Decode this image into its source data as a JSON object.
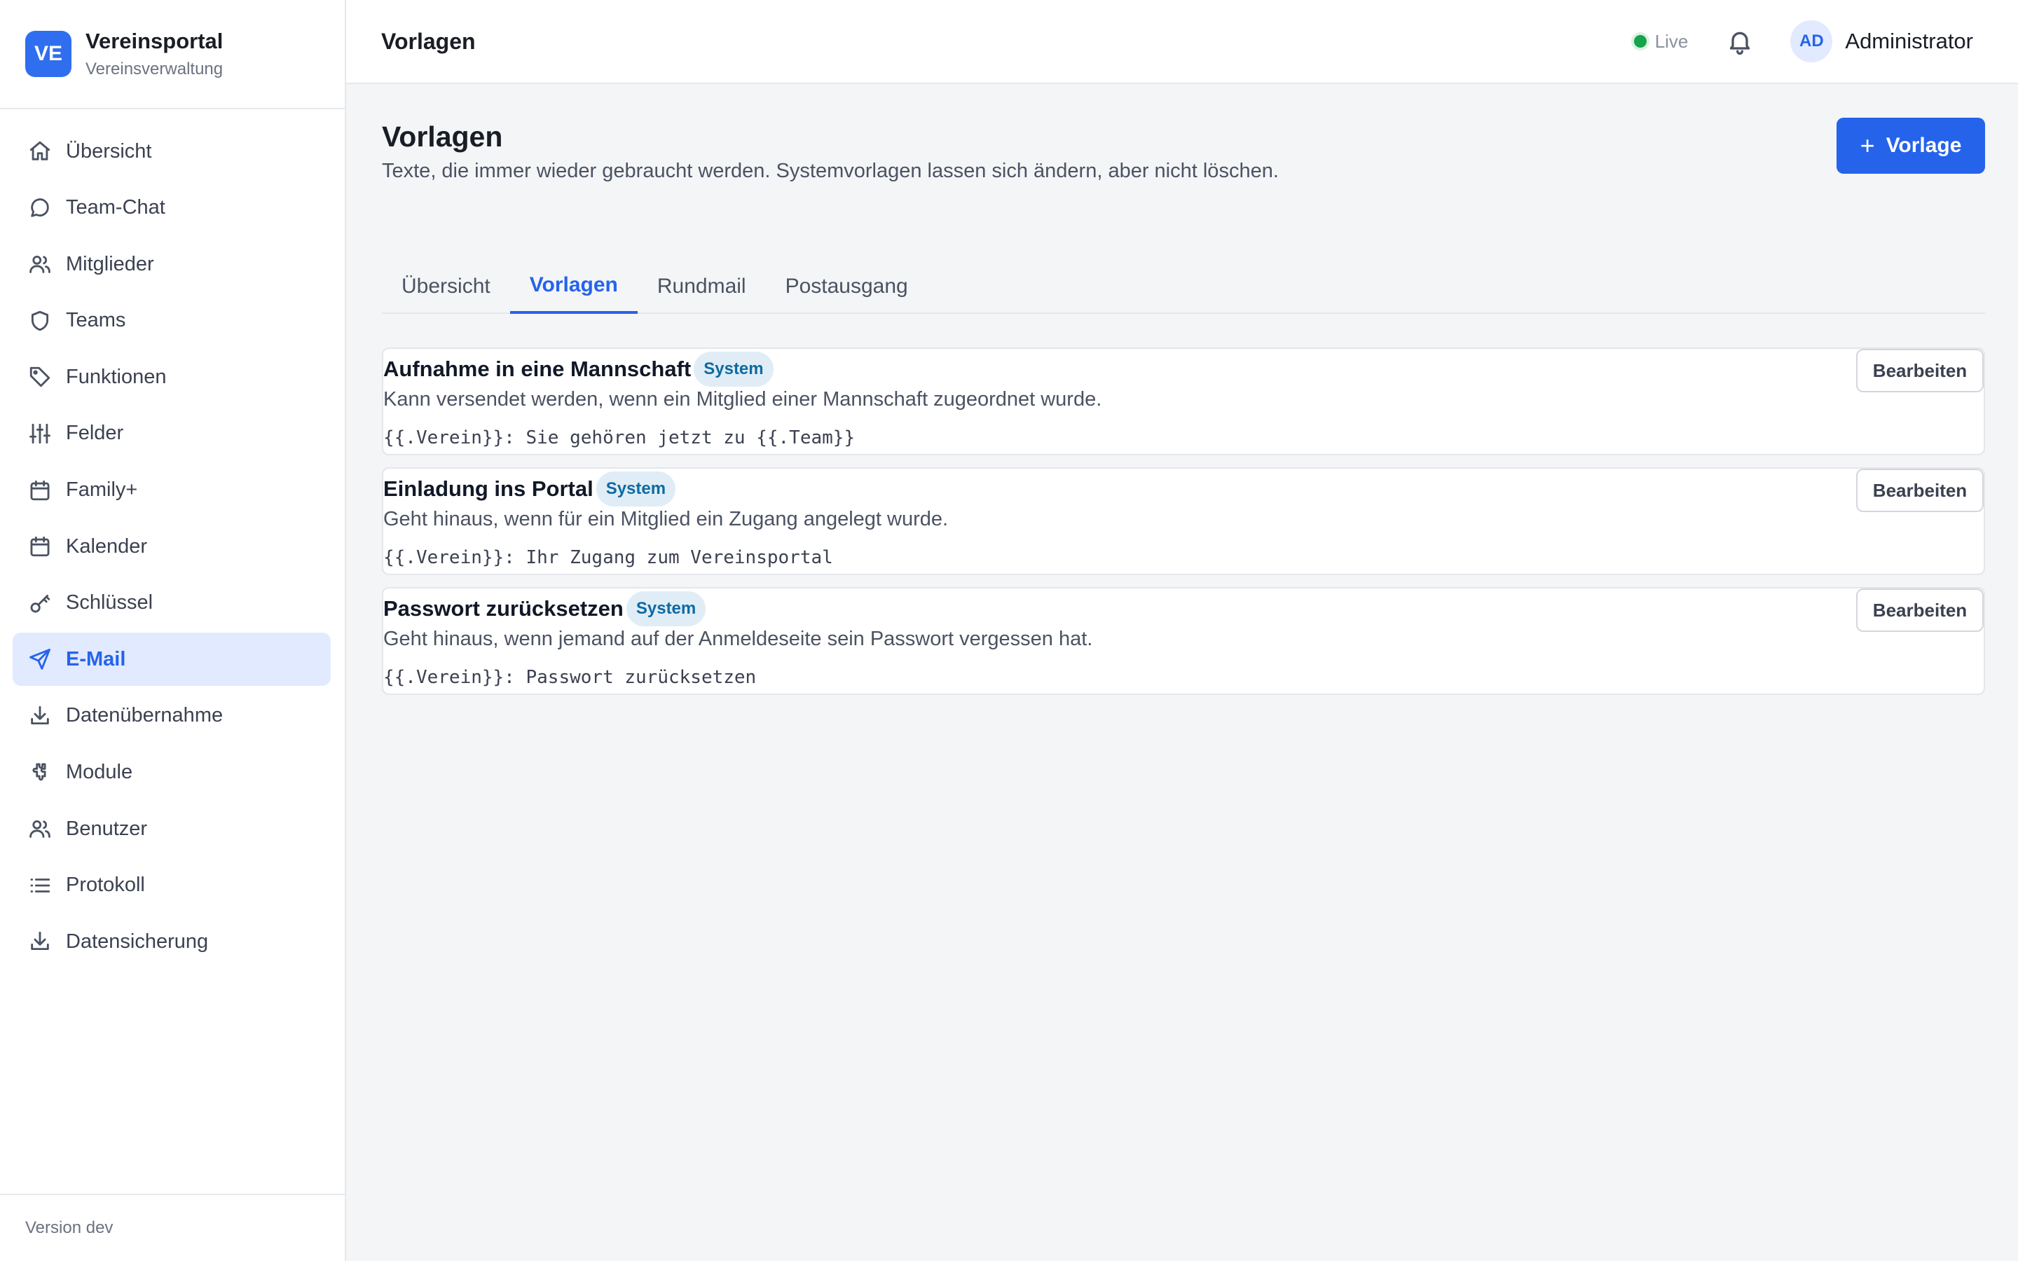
{
  "brand": {
    "logo": "VE",
    "name": "Vereinsportal",
    "subtitle": "Vereinsverwaltung"
  },
  "sidebar": {
    "items": [
      {
        "label": "Übersicht",
        "icon": "home-icon"
      },
      {
        "label": "Team-Chat",
        "icon": "chat-icon"
      },
      {
        "label": "Mitglieder",
        "icon": "users-icon"
      },
      {
        "label": "Teams",
        "icon": "shield-icon"
      },
      {
        "label": "Funktionen",
        "icon": "tag-icon"
      },
      {
        "label": "Felder",
        "icon": "sliders-icon"
      },
      {
        "label": "Family+",
        "icon": "calendar-icon"
      },
      {
        "label": "Kalender",
        "icon": "calendar-icon"
      },
      {
        "label": "Schlüssel",
        "icon": "key-icon"
      },
      {
        "label": "E-Mail",
        "icon": "send-icon",
        "active": true
      },
      {
        "label": "Datenübernahme",
        "icon": "download-icon"
      },
      {
        "label": "Module",
        "icon": "puzzle-icon"
      },
      {
        "label": "Benutzer",
        "icon": "users-icon"
      },
      {
        "label": "Protokoll",
        "icon": "list-icon"
      },
      {
        "label": "Datensicherung",
        "icon": "download-icon"
      }
    ],
    "footer": "Version dev"
  },
  "topbar": {
    "title": "Vorlagen",
    "status": "Live",
    "avatar": "AD",
    "user": "Administrator"
  },
  "page": {
    "title": "Vorlagen",
    "subtitle": "Texte, die immer wieder gebraucht werden. Systemvorlagen lassen sich ändern, aber nicht löschen.",
    "add_label": "Vorlage"
  },
  "tabs": [
    {
      "label": "Übersicht"
    },
    {
      "label": "Vorlagen",
      "active": true
    },
    {
      "label": "Rundmail"
    },
    {
      "label": "Postausgang"
    }
  ],
  "templates": [
    {
      "title": "Aufnahme in eine Mannschaft",
      "badge": "System",
      "description": "Kann versendet werden, wenn ein Mitglied einer Mannschaft zugeordnet wurde.",
      "subject": "{{.Verein}}: Sie gehören jetzt zu {{.Team}}",
      "edit_label": "Bearbeiten"
    },
    {
      "title": "Einladung ins Portal",
      "badge": "System",
      "description": "Geht hinaus, wenn für ein Mitglied ein Zugang angelegt wurde.",
      "subject": "{{.Verein}}: Ihr Zugang zum Vereinsportal",
      "edit_label": "Bearbeiten"
    },
    {
      "title": "Passwort zurücksetzen",
      "badge": "System",
      "description": "Geht hinaus, wenn jemand auf der Anmeldeseite sein Passwort vergessen hat.",
      "subject": "{{.Verein}}: Passwort zurücksetzen",
      "edit_label": "Bearbeiten"
    }
  ],
  "colors": {
    "accent": "#2563eb",
    "live": "#16a34a",
    "badge_bg": "#e0edf6",
    "badge_text": "#0e6aa3"
  }
}
